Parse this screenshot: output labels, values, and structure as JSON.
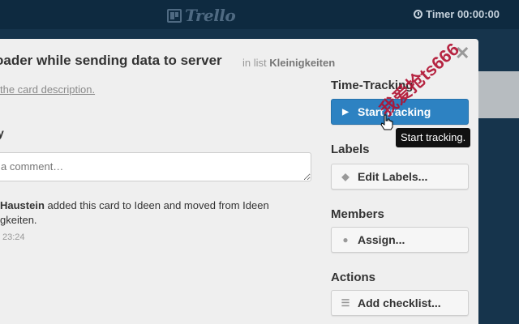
{
  "topbar": {
    "logo_text": "Trello",
    "timer_text": "Timer 00:00:00"
  },
  "card": {
    "title": "oader while sending data to server",
    "in_list_prefix": "in list",
    "list_name": "Kleinigkeiten",
    "description_link": "the card description.",
    "activity_heading": "y",
    "comment_placeholder": "a comment…",
    "activity": {
      "user": "Haustein",
      "text": "added this card to Ideen and moved from Ideen",
      "text_line2": "gkeiten.",
      "time": "23:24"
    }
  },
  "sidebar": {
    "time_tracking_heading": "Time-Tracking",
    "start_tracking_label": "Start tracking",
    "tooltip": "Start tracking.",
    "labels_heading": "Labels",
    "edit_labels_label": "Edit Labels...",
    "members_heading": "Members",
    "assign_label": "Assign...",
    "actions_heading": "Actions",
    "add_checklist_label": "Add checklist..."
  },
  "watermark_text": "我爱抢ts666",
  "colors": {
    "topbar": "#0e2a40",
    "board": "#16344c",
    "modal": "#efefef",
    "primary_button": "#2d82c2"
  }
}
